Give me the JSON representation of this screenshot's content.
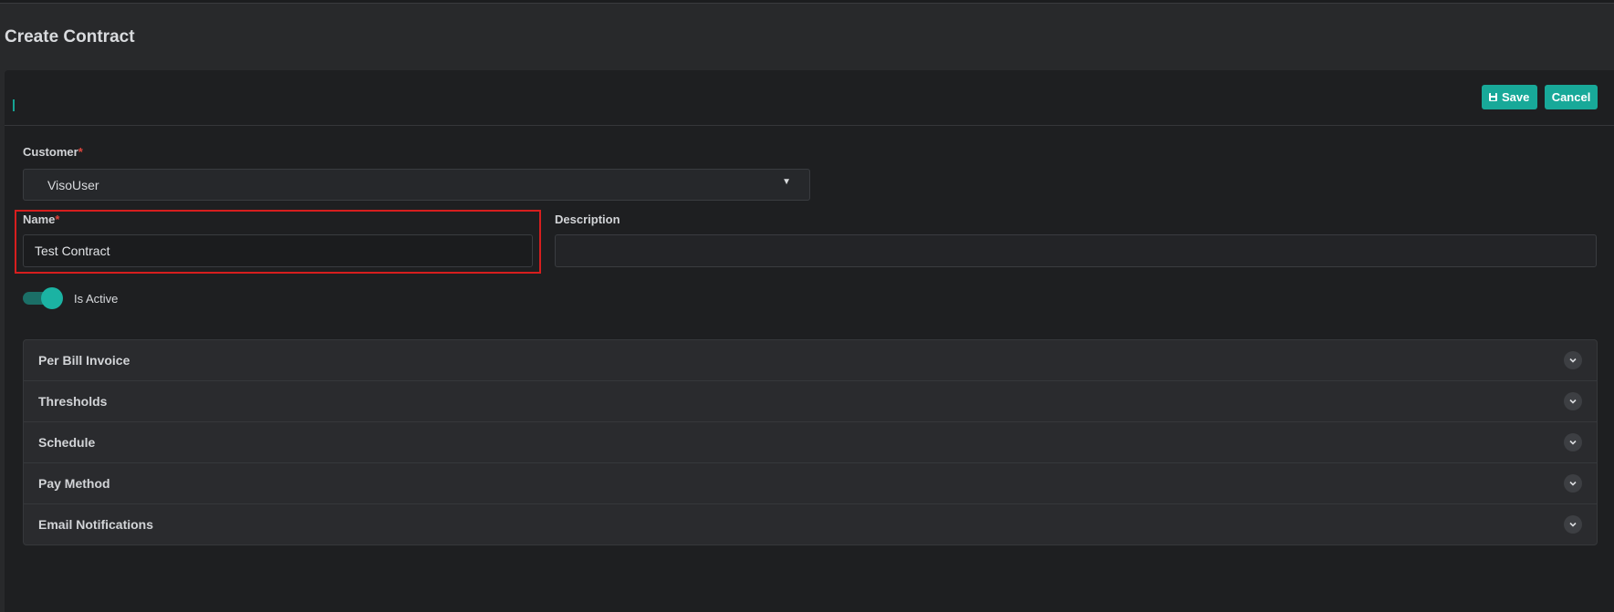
{
  "page": {
    "title": "Create Contract"
  },
  "toolbar": {
    "save_label": "Save",
    "cancel_label": "Cancel"
  },
  "form": {
    "customer_label": "Customer",
    "required_mark": "*",
    "customer_value": "VisoUser",
    "name_label": "Name",
    "name_value": "Test Contract",
    "description_label": "Description",
    "description_value": "",
    "is_active_label": "Is Active",
    "is_active": true
  },
  "sections": [
    {
      "label": "Per Bill Invoice"
    },
    {
      "label": "Thresholds"
    },
    {
      "label": "Schedule"
    },
    {
      "label": "Pay Method"
    },
    {
      "label": "Email Notifications"
    }
  ],
  "colors": {
    "accent": "#18a999",
    "required": "#e0453d",
    "highlight": "#d71e1e",
    "background": "#28292b",
    "card": "#1e1f21"
  },
  "icons": {
    "save": "floppy-disk-icon",
    "dropdown": "caret-down-icon",
    "section": "chevron-down-icon"
  }
}
